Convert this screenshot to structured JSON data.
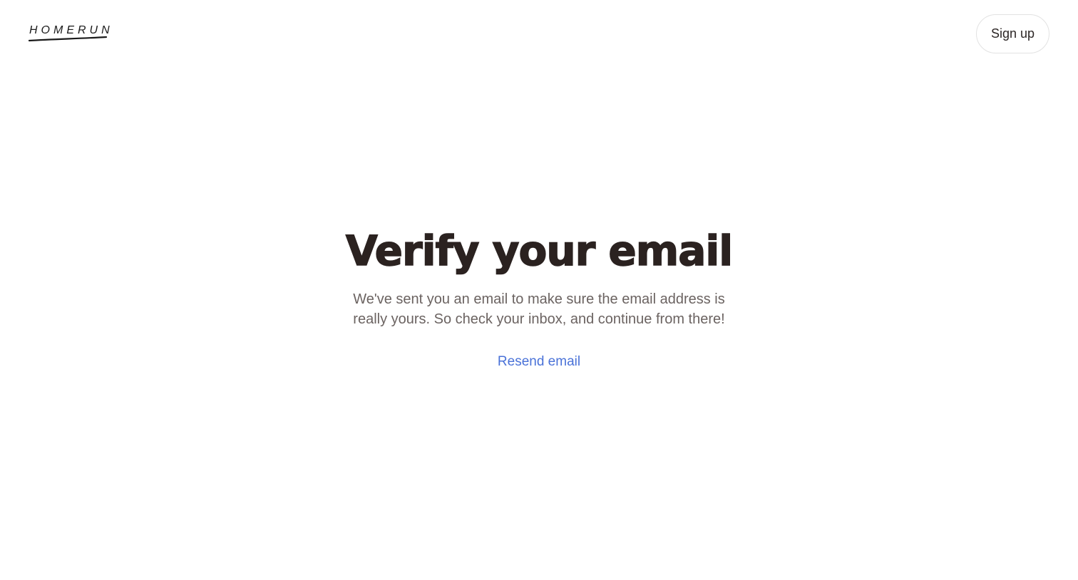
{
  "header": {
    "logo_text": "HOMERUN",
    "signup_label": "Sign up"
  },
  "main": {
    "title": "Verify your email",
    "message": "We've sent you an email to make sure the email address is really yours. So check your inbox, and continue from there!",
    "resend_label": "Resend email"
  },
  "colors": {
    "title": "#2b2220",
    "body_text": "#6b6361",
    "link": "#4a72d8",
    "button_border": "#e2e2e2",
    "background": "#ffffff"
  }
}
